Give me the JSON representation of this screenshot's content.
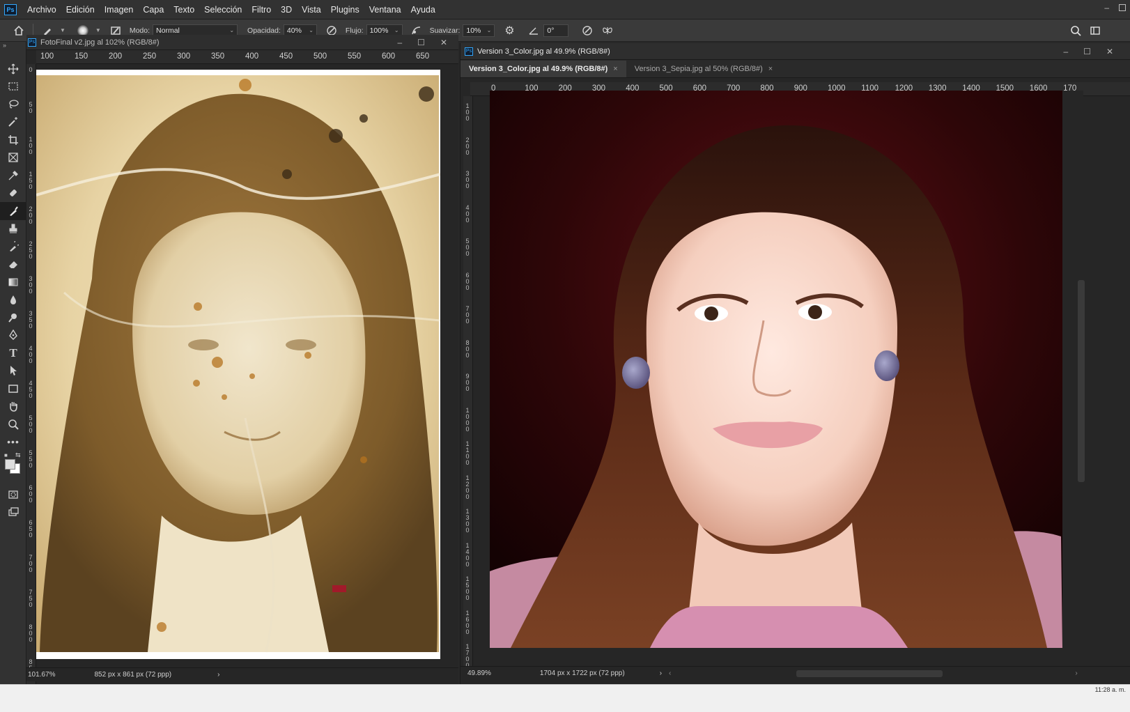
{
  "menu": [
    "Archivo",
    "Edición",
    "Imagen",
    "Capa",
    "Texto",
    "Selección",
    "Filtro",
    "3D",
    "Vista",
    "Plugins",
    "Ventana",
    "Ayuda"
  ],
  "app_logo": "Ps",
  "options": {
    "modo_label": "Modo:",
    "modo_value": "Normal",
    "opacidad_label": "Opacidad:",
    "opacidad_value": "40%",
    "flujo_label": "Flujo:",
    "flujo_value": "100%",
    "suavizar_label": "Suavizar:",
    "suavizar_value": "10%",
    "angle_value": "0°"
  },
  "left_doc": {
    "title": "FotoFinal v2.jpg al 102% (RGB/8#)",
    "ruler_h": [
      "100",
      "150",
      "200",
      "250",
      "300",
      "350",
      "400",
      "450",
      "500",
      "550",
      "600",
      "650"
    ],
    "ruler_v": [
      "0",
      "5 0",
      "1 0 0",
      "1 5 0",
      "2 0 0",
      "2 5 0",
      "3 0 0",
      "3 5 0",
      "4 0 0",
      "4 5 0",
      "5 0 0",
      "5 5 0",
      "6 0 0",
      "6 5 0",
      "7 0 0",
      "7 5 0",
      "8 0 0",
      "8 5"
    ],
    "zoom": "101.67%",
    "size": "852 px x 861 px (72 ppp)"
  },
  "right_doc": {
    "title": "Version 3_Color.jpg al 49.9% (RGB/8#)",
    "tabs": [
      {
        "label": "Version 3_Color.jpg al 49.9% (RGB/8#)",
        "close": "×"
      },
      {
        "label": "Version 3_Sepia.jpg al 50% (RGB/8#)",
        "close": "×"
      }
    ],
    "ruler_h": [
      "0",
      "100",
      "200",
      "300",
      "400",
      "500",
      "600",
      "700",
      "800",
      "900",
      "1000",
      "1100",
      "1200",
      "1300",
      "1400",
      "1500",
      "1600",
      "170"
    ],
    "ruler_v": [
      "1 0 0",
      "2 0 0",
      "3 0 0",
      "4 0 0",
      "5 0 0",
      "6 0 0",
      "7 0 0",
      "8 0 0",
      "9 0 0",
      "1 0 0 0",
      "1 1 0 0",
      "1 2 0 0",
      "1 3 0 0",
      "1 4 0 0",
      "1 5 0 0",
      "1 6 0 0",
      "1 7 0 0"
    ],
    "zoom": "49.89%",
    "size": "1704 px x 1722 px (72 ppp)"
  },
  "window_ctrls": {
    "min": "–",
    "max": "☐",
    "close": "✕"
  },
  "clock": "11:28 a. m."
}
